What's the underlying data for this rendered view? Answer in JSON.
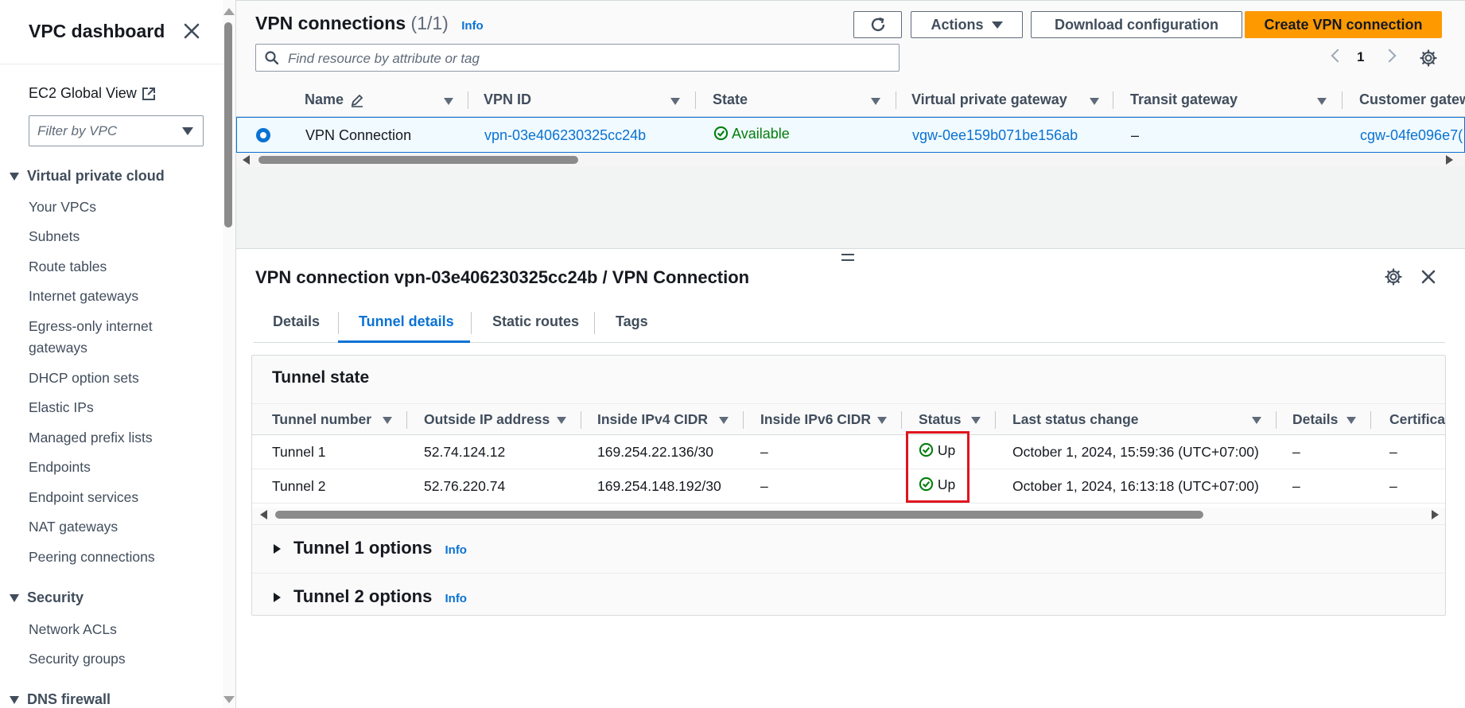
{
  "sidebar": {
    "title": "VPC dashboard",
    "global_view": "EC2 Global View",
    "filter_placeholder": "Filter by VPC",
    "sections": [
      {
        "label": "Virtual private cloud",
        "items": [
          "Your VPCs",
          "Subnets",
          "Route tables",
          "Internet gateways",
          "Egress-only internet gateways",
          "DHCP option sets",
          "Elastic IPs",
          "Managed prefix lists",
          "Endpoints",
          "Endpoint services",
          "NAT gateways",
          "Peering connections"
        ]
      },
      {
        "label": "Security",
        "items": [
          "Network ACLs",
          "Security groups"
        ]
      },
      {
        "label": "DNS firewall",
        "items": []
      }
    ]
  },
  "list": {
    "title": "VPN connections",
    "count": "(1/1)",
    "info": "Info",
    "buttons": {
      "actions": "Actions",
      "download": "Download configuration",
      "create": "Create VPN connection"
    },
    "search_placeholder": "Find resource by attribute or tag",
    "page": "1",
    "columns": [
      "Name",
      "VPN ID",
      "State",
      "Virtual private gateway",
      "Transit gateway",
      "Customer gatew"
    ],
    "row": {
      "name": "VPN Connection",
      "vpn_id": "vpn-03e406230325cc24b",
      "state": "Available",
      "vgw": "vgw-0ee159b071be156ab",
      "tgw": "–",
      "cgw": "cgw-04fe096e7("
    }
  },
  "detail": {
    "title": "VPN connection vpn-03e406230325cc24b / VPN Connection",
    "tabs": [
      "Details",
      "Tunnel details",
      "Static routes",
      "Tags"
    ],
    "active_tab": "Tunnel details",
    "tunnel_state": {
      "title": "Tunnel state",
      "columns": [
        "Tunnel number",
        "Outside IP address",
        "Inside IPv4 CIDR",
        "Inside IPv6 CIDR",
        "Status",
        "Last status change",
        "Details",
        "Certifica"
      ],
      "rows": [
        {
          "tunnel": "Tunnel 1",
          "outside_ip": "52.74.124.12",
          "ipv4": "169.254.22.136/30",
          "ipv6": "–",
          "status": "Up",
          "last_change": "October 1, 2024, 15:59:36 (UTC+07:00)",
          "details": "–",
          "cert": "–"
        },
        {
          "tunnel": "Tunnel 2",
          "outside_ip": "52.76.220.74",
          "ipv4": "169.254.148.192/30",
          "ipv6": "–",
          "status": "Up",
          "last_change": "October 1, 2024, 16:13:18 (UTC+07:00)",
          "details": "–",
          "cert": "–"
        }
      ]
    },
    "options": [
      {
        "label": "Tunnel 1 options",
        "info": "Info"
      },
      {
        "label": "Tunnel 2 options",
        "info": "Info"
      }
    ]
  },
  "colors": {
    "accent": "#0972d3",
    "primary_button": "#ff9900",
    "success": "#037f0c",
    "highlight": "#e0141e"
  },
  "icons": [
    "close-icon",
    "external-link-icon",
    "refresh-icon",
    "search-icon",
    "settings-icon",
    "edit-icon",
    "status-check-icon"
  ]
}
